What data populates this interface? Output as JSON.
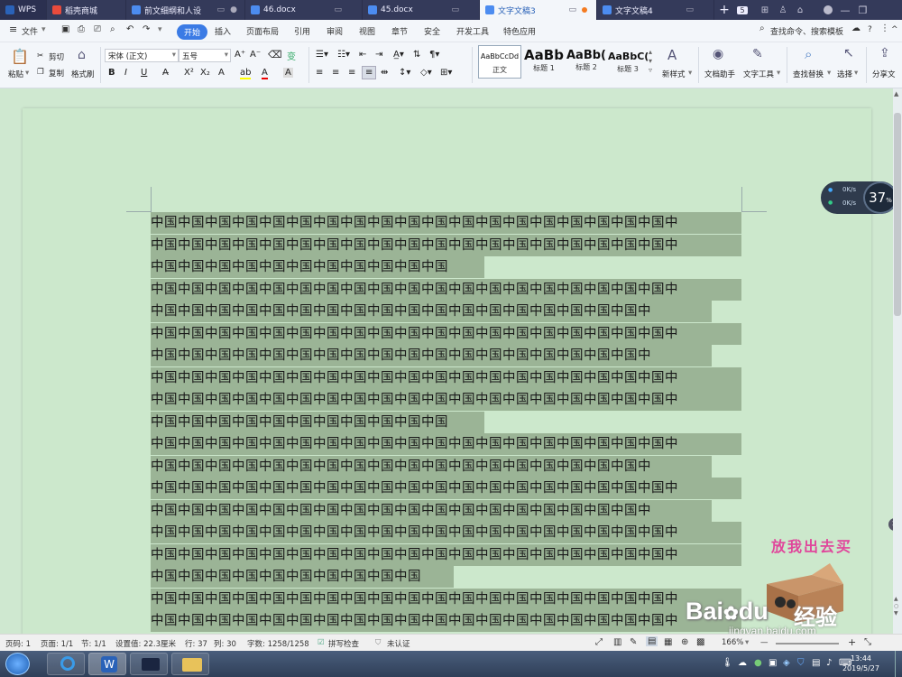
{
  "tabs": [
    {
      "label": "WPS",
      "color": "#2a62b8"
    },
    {
      "label": "稻壳商城",
      "color": "#e94b3c"
    },
    {
      "label": "前文细纲和人设",
      "color": "#2a62b8"
    },
    {
      "label": "46.docx",
      "color": "#2a62b8"
    },
    {
      "label": "45.docx",
      "color": "#2a62b8"
    },
    {
      "label": "文字文稿3",
      "color": "#2a62b8"
    },
    {
      "label": "文字文稿4",
      "color": "#2a62b8"
    }
  ],
  "tab_count": "5",
  "menu": {
    "file": "文件",
    "items": [
      "开始",
      "插入",
      "页面布局",
      "引用",
      "审阅",
      "视图",
      "章节",
      "安全",
      "开发工具",
      "特色应用"
    ],
    "search": "查找命令、搜索模板"
  },
  "ribbon": {
    "paste": "粘贴",
    "cut": "剪切",
    "copy": "复制",
    "format_painter": "格式刷",
    "font": "宋体 (正文)",
    "size": "五号",
    "styles": [
      {
        "preview": "AaBbCcDd",
        "label": "正文"
      },
      {
        "preview": "AaBb",
        "label": "标题 1"
      },
      {
        "preview": "AaBb(",
        "label": "标题 2"
      },
      {
        "preview": "AaBbC(",
        "label": "标题 3"
      }
    ],
    "new_style": "新样式",
    "doc_assistant": "文档助手",
    "text_tools": "文字工具",
    "find_replace": "查找替换",
    "select": "选择",
    "share": "分享文"
  },
  "speed": {
    "up": "0K/s",
    "down": "0K/s",
    "percent": "37",
    "unit": "%"
  },
  "doc_text": "中国",
  "doc_lines_chars": [
    39,
    39,
    22,
    39,
    37,
    39,
    37,
    39,
    39,
    22,
    39,
    37,
    39,
    37,
    39,
    39,
    20,
    39,
    39
  ],
  "status": {
    "page": "页码: 1",
    "pages": "页面: 1/1",
    "section": "节: 1/1",
    "setting": "设置值: 22.3厘米",
    "row": "行: 37",
    "col": "列: 30",
    "words": "字数: 1258/1258",
    "spell": "拼写检查",
    "cert": "未认证",
    "zoom": "166%"
  },
  "watermark": {
    "slogan": "放我出去买",
    "brand": "Bai",
    "brand2": "du",
    "jingyan": "经验",
    "url": "jingyan.baidu.com"
  },
  "clock": {
    "time": "13:44",
    "date": "2019/5/27"
  }
}
